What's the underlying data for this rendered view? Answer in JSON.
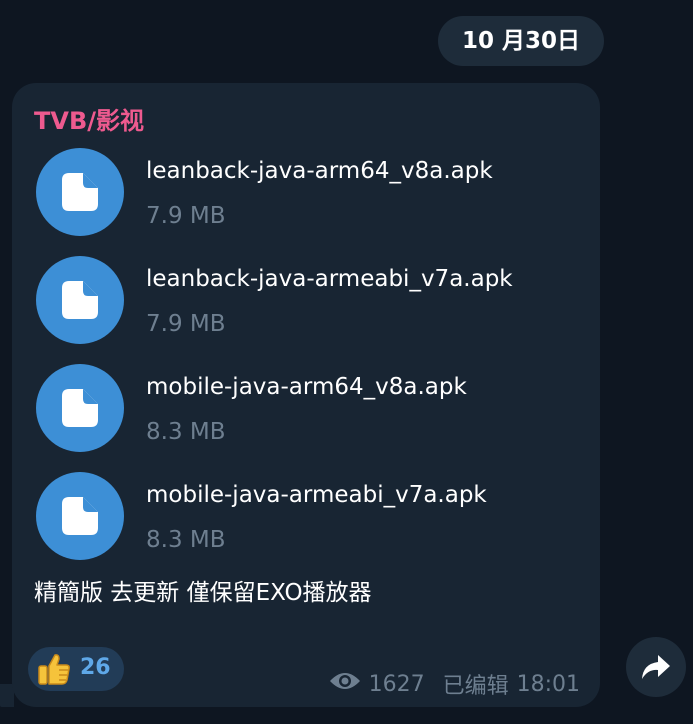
{
  "date_label": "10 月30日",
  "message": {
    "sender": "TVB/影视",
    "files": [
      {
        "name": "leanback-java-arm64_v8a.apk",
        "size": "7.9 MB",
        "icon": "file-icon"
      },
      {
        "name": "leanback-java-armeabi_v7a.apk",
        "size": "7.9 MB",
        "icon": "file-icon"
      },
      {
        "name": "mobile-java-arm64_v8a.apk",
        "size": "8.3 MB",
        "icon": "file-icon"
      },
      {
        "name": "mobile-java-armeabi_v7a.apk",
        "size": "8.3 MB",
        "icon": "file-icon"
      }
    ],
    "caption": "精簡版 去更新 僅保留EXO播放器",
    "reaction": {
      "emoji": "thumbs-up-icon",
      "count": "26"
    },
    "views": "1627",
    "edited_label": "已编辑",
    "time": "18:01"
  },
  "forward_icon": "forward-arrow-icon",
  "colors": {
    "background": "#0e1621",
    "bubble": "#182533",
    "sender": "#ee5a8f",
    "file_icon_bg": "#3d8fd6",
    "muted_text": "#6e7f90",
    "reaction_count": "#5fa8e8"
  }
}
